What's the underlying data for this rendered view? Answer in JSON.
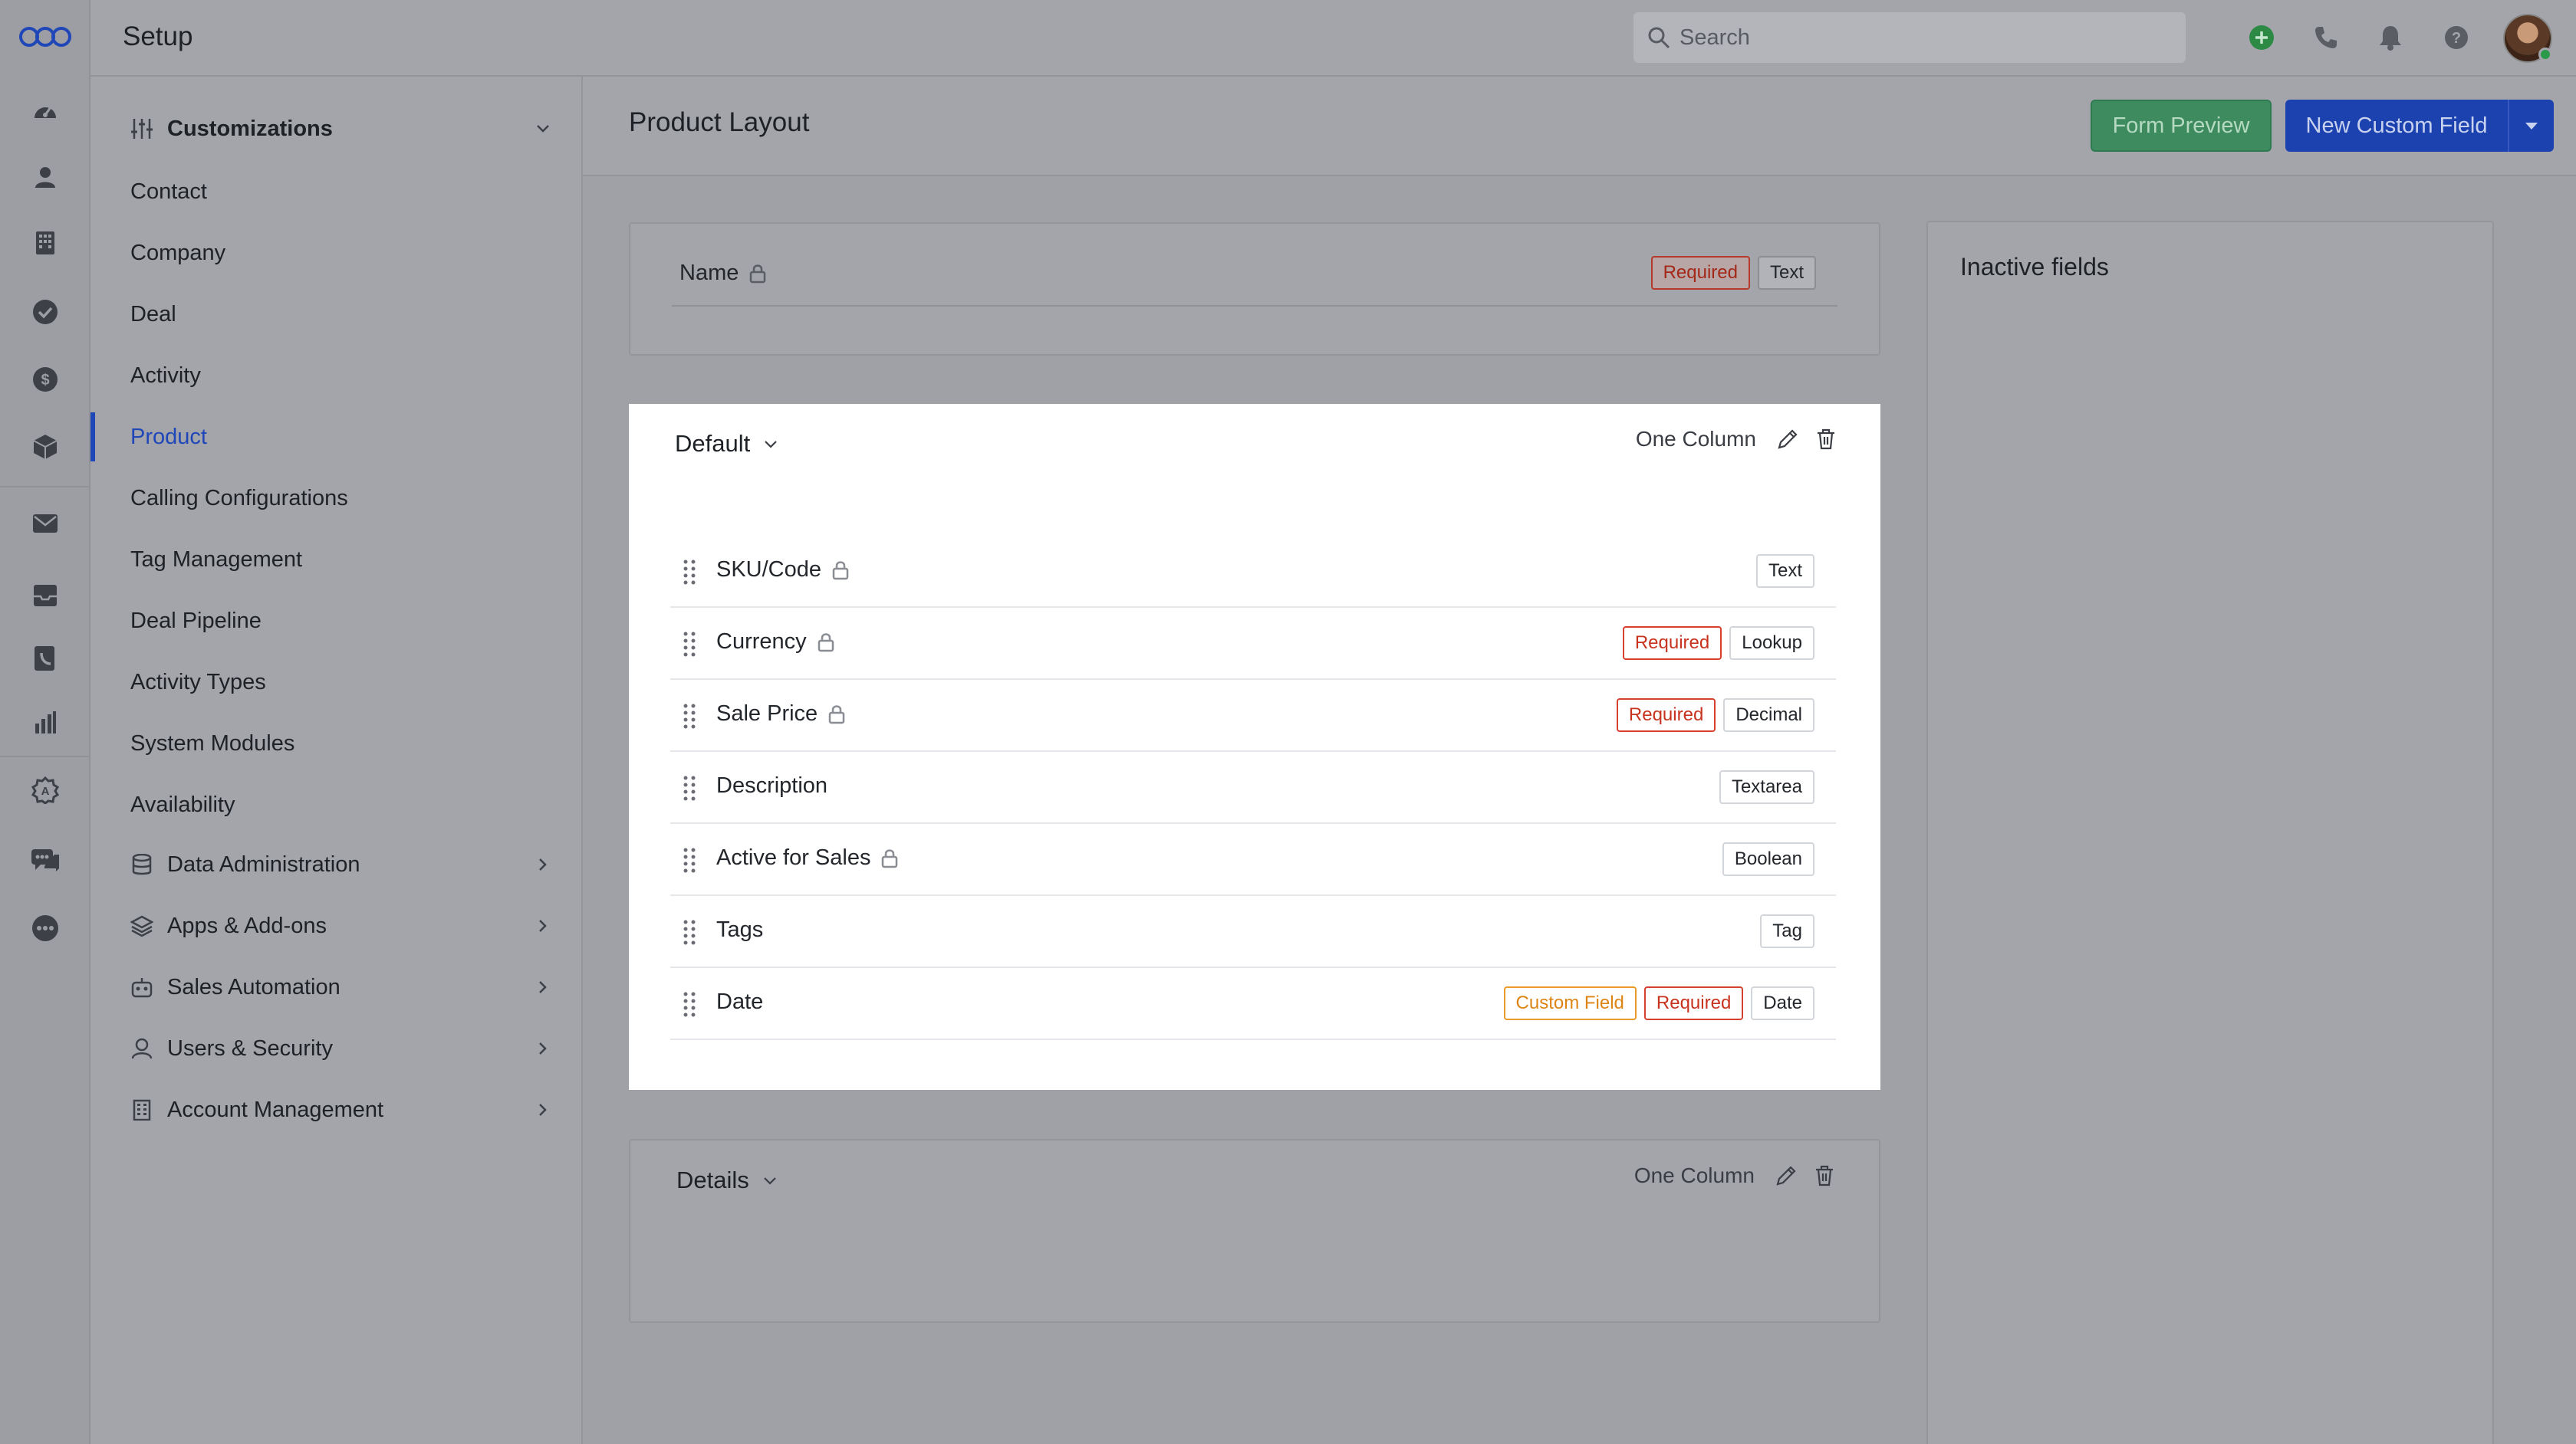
{
  "topbar": {
    "title": "Setup",
    "search_placeholder": "Search"
  },
  "sidebar": {
    "customizations": "Customizations",
    "items": [
      "Contact",
      "Company",
      "Deal",
      "Activity",
      "Product",
      "Calling Configurations",
      "Tag Management",
      "Deal Pipeline",
      "Activity Types",
      "System Modules",
      "Availability"
    ],
    "active_item": "Product",
    "groups": [
      "Data Administration",
      "Apps & Add-ons",
      "Sales Automation",
      "Users & Security",
      "Account Management"
    ]
  },
  "main": {
    "title": "Product Layout",
    "form_preview": "Form Preview",
    "new_custom_field": "New Custom Field",
    "name_field": {
      "label": "Name",
      "tags": [
        "Required",
        "Text"
      ]
    },
    "sections": [
      {
        "title": "Default",
        "columns": "One Column",
        "fields": [
          {
            "label": "SKU/Code",
            "locked": true,
            "tags": [
              "Text"
            ]
          },
          {
            "label": "Currency",
            "locked": true,
            "tags": [
              "Required",
              "Lookup"
            ]
          },
          {
            "label": "Sale Price",
            "locked": true,
            "tags": [
              "Required",
              "Decimal"
            ]
          },
          {
            "label": "Description",
            "locked": false,
            "tags": [
              "Textarea"
            ]
          },
          {
            "label": "Active for Sales",
            "locked": true,
            "tags": [
              "Boolean"
            ]
          },
          {
            "label": "Tags",
            "locked": false,
            "tags": [
              "Tag"
            ]
          },
          {
            "label": "Date",
            "locked": false,
            "tags": [
              "Custom Field",
              "Required",
              "Date"
            ]
          }
        ]
      },
      {
        "title": "Details",
        "columns": "One Column",
        "fields": []
      }
    ],
    "inactive_fields_title": "Inactive fields"
  },
  "colors": {
    "accent": "#1f47b8",
    "preview_button": "#3d8b5f",
    "required": "#d5402f",
    "custom_field": "#ec9a2a"
  }
}
